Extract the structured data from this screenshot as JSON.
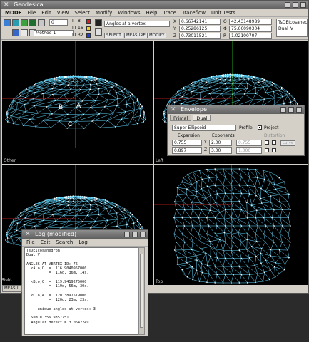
{
  "main_window": {
    "title": "Geodesica",
    "menu": [
      "MODE",
      "File",
      "Edit",
      "View",
      "Select",
      "Modify",
      "Windows",
      "Help",
      "Trace",
      "Traceflow",
      "Unit Tests"
    ],
    "toolbar": {
      "count_value": "0",
      "method_select": "Method 1",
      "levels": [
        "II",
        "III",
        "III"
      ],
      "level_numbers": [
        "8",
        "16",
        "32"
      ],
      "measure_select": "Angles at a vertex",
      "mode_buttons": [
        "SELECT",
        "MEASURE",
        "MODIFY"
      ],
      "coords": {
        "x": "0.66742141",
        "y": "0.25286125",
        "z": "0.73011521",
        "a": "42.43148989",
        "b": "75.66090304",
        "c": "1.02100707"
      },
      "object_list": [
        "TsDEIcosahec",
        "Dual_V"
      ]
    },
    "colors": {
      "accent_red": "#d81e1e",
      "accent_yellow": "#f0d020",
      "accent_blue": "#2040d0"
    }
  },
  "viewports": [
    {
      "label": "Other",
      "vertex_labels": [
        "B",
        "A",
        "C"
      ]
    },
    {
      "label": "Left"
    },
    {
      "label": "Right"
    },
    {
      "label": "Top"
    }
  ],
  "envelope": {
    "title": "Envelope",
    "tabs": [
      "Primal",
      "Dual"
    ],
    "active_tab": "Dual",
    "shape_select": "Super Ellipsoid",
    "profile_label": "Profile",
    "project_label": "Project",
    "project_checked": true,
    "expansion_label": "Expansion",
    "exponents_label": "Exponents",
    "distortion_label": "Distortion",
    "expansion": [
      "0.755",
      "0.897"
    ],
    "axis_labels": [
      "Y",
      "Z"
    ],
    "exponents": [
      "2.00",
      "3.00"
    ],
    "distortion": [
      "0.755",
      "1.000"
    ],
    "curve_button": "curve"
  },
  "log": {
    "title": "Log (modified)",
    "menu": [
      "File",
      "Edit",
      "Search",
      "Log"
    ],
    "lines": [
      "TsDEIcosahedron",
      "Dual_V",
      "",
      "ANGLES AT VERTEX ID: 76",
      "  <A,o,O  =  116.9040957000",
      "          =  116d, 36m, 14s.",
      "",
      "  <B,o,C  =  119.9419275000",
      "          =  119d, 56m, 30s.",
      "",
      "  <C,o,A  =  120.3897519000",
      "          =  120d, 23m, 23s.",
      "",
      "  -- unique angles at vertex: 3",
      "",
      "  Sum = 356.9357751",
      "  Angular defect = 3.0642249"
    ]
  },
  "desktop": {
    "status_left": "Right",
    "measure_tab": "MEASU"
  }
}
